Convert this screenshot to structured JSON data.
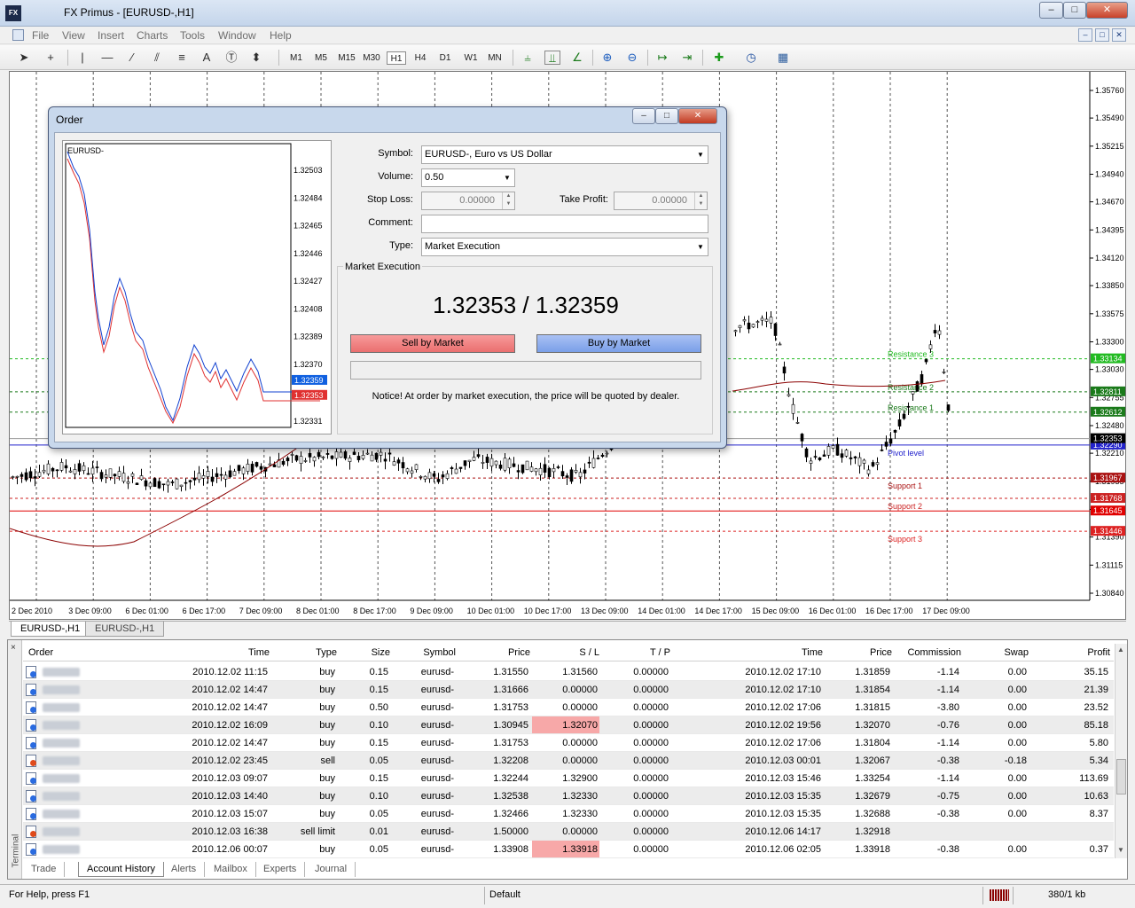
{
  "window": {
    "title": "FX Primus - [EURUSD-,H1]",
    "logo_text": "FX",
    "min": "–",
    "max": "□",
    "close": "✕"
  },
  "menu": [
    "File",
    "View",
    "Insert",
    "Charts",
    "Tools",
    "Window",
    "Help"
  ],
  "toolbar": {
    "periods": [
      "M1",
      "M5",
      "M15",
      "M30",
      "H1",
      "H4",
      "D1",
      "W1",
      "MN"
    ],
    "active_period": "H1"
  },
  "chart": {
    "price_axis": [
      "1.35760",
      "1.35490",
      "1.35215",
      "1.34940",
      "1.34670",
      "1.34395",
      "1.34120",
      "1.33850",
      "1.33575",
      "1.33300",
      "1.33030",
      "1.32755",
      "1.32480",
      "1.32210",
      "1.31935",
      "1.31660",
      "1.31390",
      "1.31115",
      "1.30840"
    ],
    "time_axis": [
      "2 Dec 2010",
      "3 Dec 09:00",
      "6 Dec 01:00",
      "6 Dec 17:00",
      "7 Dec 09:00",
      "8 Dec 01:00",
      "8 Dec 17:00",
      "9 Dec 09:00",
      "10 Dec 01:00",
      "10 Dec 17:00",
      "13 Dec 09:00",
      "14 Dec 01:00",
      "14 Dec 17:00",
      "15 Dec 09:00",
      "16 Dec 01:00",
      "16 Dec 17:00",
      "17 Dec 09:00"
    ],
    "levels": [
      {
        "name": "Resistance 3",
        "price": "1.33134",
        "color": "#22bb22"
      },
      {
        "name": "Resistance 2",
        "price": "1.32811",
        "color": "#1a7a1a"
      },
      {
        "name": "Resistance 1",
        "price": "1.32612",
        "color": "#1a7a1a"
      },
      {
        "name": "Pivot level",
        "price": "1.32290",
        "color": "#2222cc"
      },
      {
        "name": "Support 1",
        "price": "1.31967",
        "color": "#aa1111"
      },
      {
        "name": "Support 2",
        "price": "1.31768",
        "color": "#cc2222"
      },
      {
        "name": "Support 3",
        "price": "1.31446",
        "color": "#dd2222"
      }
    ],
    "bid_label": "1.32353",
    "extra_label": "1.31645",
    "tabs": [
      "EURUSD-,H1",
      "EURUSD-,H1"
    ]
  },
  "order": {
    "title": "Order",
    "mini_chart": {
      "symbol": "EURUSD-",
      "axis": [
        "1.32503",
        "1.32484",
        "1.32465",
        "1.32446",
        "1.32427",
        "1.32408",
        "1.32389",
        "1.32370",
        "1.32331"
      ],
      "ask": "1.32359",
      "bid": "1.32353"
    },
    "labels": {
      "symbol": "Symbol:",
      "volume": "Volume:",
      "stop_loss": "Stop Loss:",
      "take_profit": "Take Profit:",
      "comment": "Comment:",
      "type": "Type:"
    },
    "symbol_value": "EURUSD-, Euro vs US Dollar",
    "volume_value": "0.50",
    "stop_loss_value": "0.00000",
    "take_profit_value": "0.00000",
    "comment_value": "",
    "type_value": "Market Execution",
    "panel_title": "Market Execution",
    "price_text": "1.32353 / 1.32359",
    "sell_label": "Sell by Market",
    "buy_label": "Buy by Market",
    "notice": "Notice! At order by market execution, the price will be quoted by dealer."
  },
  "terminal": {
    "side_label": "Terminal",
    "close": "×",
    "columns": [
      "Order",
      "Time",
      "Type",
      "Size",
      "Symbol",
      "Price",
      "S / L",
      "T / P",
      "Time",
      "Price",
      "Commission",
      "Swap",
      "Profit"
    ],
    "rows": [
      {
        "time": "2010.12.02 11:15",
        "type": "buy",
        "size": "0.15",
        "symbol": "eurusd-",
        "price": "1.31550",
        "sl": "1.31560",
        "tp": "0.00000",
        "ctime": "2010.12.02 17:10",
        "cprice": "1.31859",
        "comm": "-1.14",
        "swap": "0.00",
        "profit": "35.15",
        "hl": false
      },
      {
        "time": "2010.12.02 14:47",
        "type": "buy",
        "size": "0.15",
        "symbol": "eurusd-",
        "price": "1.31666",
        "sl": "0.00000",
        "tp": "0.00000",
        "ctime": "2010.12.02 17:10",
        "cprice": "1.31854",
        "comm": "-1.14",
        "swap": "0.00",
        "profit": "21.39",
        "hl": false
      },
      {
        "time": "2010.12.02 14:47",
        "type": "buy",
        "size": "0.50",
        "symbol": "eurusd-",
        "price": "1.31753",
        "sl": "0.00000",
        "tp": "0.00000",
        "ctime": "2010.12.02 17:06",
        "cprice": "1.31815",
        "comm": "-3.80",
        "swap": "0.00",
        "profit": "23.52",
        "hl": false
      },
      {
        "time": "2010.12.02 16:09",
        "type": "buy",
        "size": "0.10",
        "symbol": "eurusd-",
        "price": "1.30945",
        "sl": "1.32070",
        "tp": "0.00000",
        "ctime": "2010.12.02 19:56",
        "cprice": "1.32070",
        "comm": "-0.76",
        "swap": "0.00",
        "profit": "85.18",
        "hl": true
      },
      {
        "time": "2010.12.02 14:47",
        "type": "buy",
        "size": "0.15",
        "symbol": "eurusd-",
        "price": "1.31753",
        "sl": "0.00000",
        "tp": "0.00000",
        "ctime": "2010.12.02 17:06",
        "cprice": "1.31804",
        "comm": "-1.14",
        "swap": "0.00",
        "profit": "5.80",
        "hl": false
      },
      {
        "time": "2010.12.02 23:45",
        "type": "sell",
        "size": "0.05",
        "symbol": "eurusd-",
        "price": "1.32208",
        "sl": "0.00000",
        "tp": "0.00000",
        "ctime": "2010.12.03 00:01",
        "cprice": "1.32067",
        "comm": "-0.38",
        "swap": "-0.18",
        "profit": "5.34",
        "hl": false
      },
      {
        "time": "2010.12.03 09:07",
        "type": "buy",
        "size": "0.15",
        "symbol": "eurusd-",
        "price": "1.32244",
        "sl": "1.32900",
        "tp": "0.00000",
        "ctime": "2010.12.03 15:46",
        "cprice": "1.33254",
        "comm": "-1.14",
        "swap": "0.00",
        "profit": "113.69",
        "hl": false
      },
      {
        "time": "2010.12.03 14:40",
        "type": "buy",
        "size": "0.10",
        "symbol": "eurusd-",
        "price": "1.32538",
        "sl": "1.32330",
        "tp": "0.00000",
        "ctime": "2010.12.03 15:35",
        "cprice": "1.32679",
        "comm": "-0.75",
        "swap": "0.00",
        "profit": "10.63",
        "hl": false
      },
      {
        "time": "2010.12.03 15:07",
        "type": "buy",
        "size": "0.05",
        "symbol": "eurusd-",
        "price": "1.32466",
        "sl": "1.32330",
        "tp": "0.00000",
        "ctime": "2010.12.03 15:35",
        "cprice": "1.32688",
        "comm": "-0.38",
        "swap": "0.00",
        "profit": "8.37",
        "hl": false
      },
      {
        "time": "2010.12.03 16:38",
        "type": "sell limit",
        "size": "0.01",
        "symbol": "eurusd-",
        "price": "1.50000",
        "sl": "0.00000",
        "tp": "0.00000",
        "ctime": "2010.12.06 14:17",
        "cprice": "1.32918",
        "comm": "",
        "swap": "",
        "profit": "",
        "hl": false
      },
      {
        "time": "2010.12.06 00:07",
        "type": "buy",
        "size": "0.05",
        "symbol": "eurusd-",
        "price": "1.33908",
        "sl": "1.33918",
        "tp": "0.00000",
        "ctime": "2010.12.06 02:05",
        "cprice": "1.33918",
        "comm": "-0.38",
        "swap": "0.00",
        "profit": "0.37",
        "hl": true
      }
    ],
    "tabs": [
      "Trade",
      "Account History",
      "Alerts",
      "Mailbox",
      "Experts",
      "Journal"
    ],
    "active_tab": "Account History"
  },
  "status": {
    "help": "For Help, press F1",
    "profile": "Default",
    "traffic": "380/1 kb"
  }
}
